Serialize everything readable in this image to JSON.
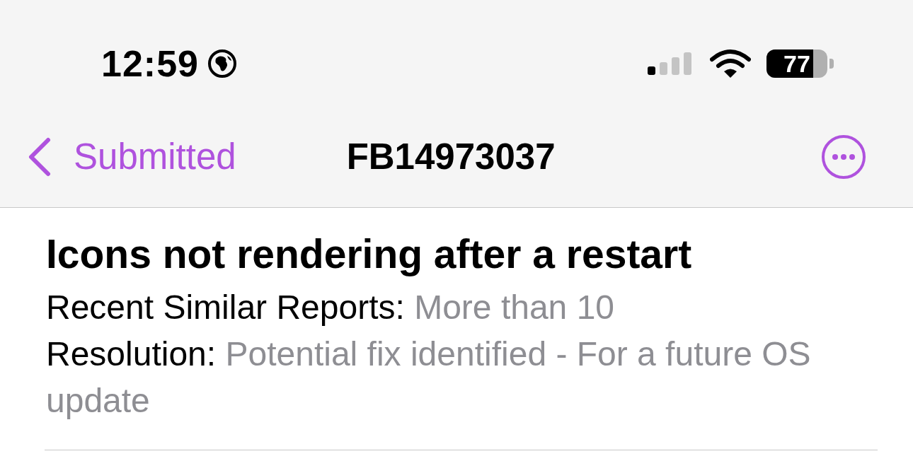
{
  "status_bar": {
    "time": "12:59",
    "battery": "77"
  },
  "nav": {
    "back": "Submitted",
    "title": "FB14973037"
  },
  "report": {
    "title": "Icons not rendering after a restart",
    "fields": [
      {
        "label": "Recent Similar Reports:",
        "value": "More than 10"
      },
      {
        "label": "Resolution:",
        "value": "Potential fix identified - For a future OS update"
      }
    ]
  }
}
